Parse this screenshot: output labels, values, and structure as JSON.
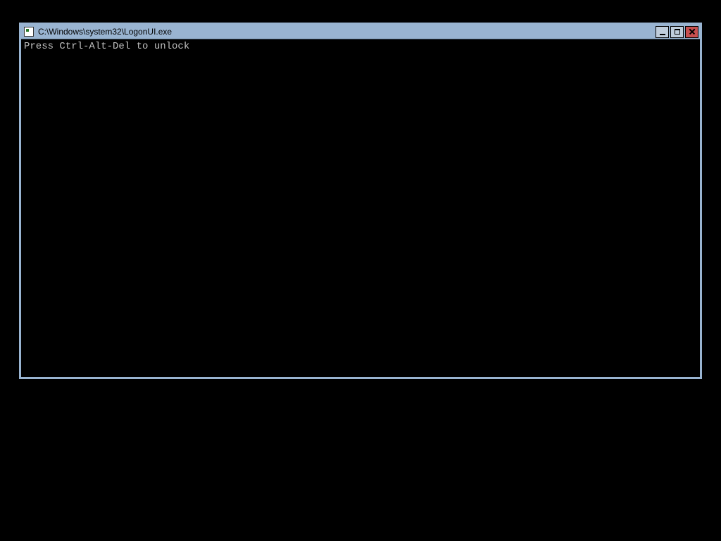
{
  "window": {
    "title": "C:\\Windows\\system32\\LogonUI.exe"
  },
  "console": {
    "line1": "Press Ctrl-Alt-Del to unlock"
  },
  "colors": {
    "frame": "#99b4d1",
    "console_bg": "#000000",
    "console_fg": "#c0c0c0",
    "close_bg": "#c75050"
  }
}
